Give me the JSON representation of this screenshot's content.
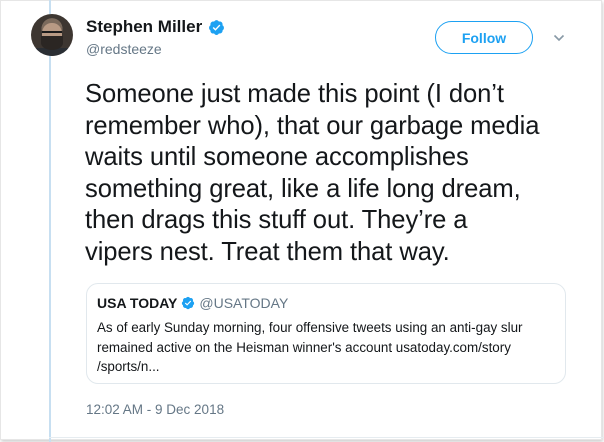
{
  "author": {
    "display_name": "Stephen Miller",
    "handle": "@redsteeze",
    "verified": true
  },
  "follow_button": {
    "label": "Follow"
  },
  "menu": {
    "icon": "chevron-down-icon"
  },
  "tweet": {
    "text": "Someone just made this point (I don’t\nremember who), that our garbage media\nwaits until someone  accomplishes\nsomething great, like a life long dream,\nthen drags this stuff out. They’re a\nvipers nest. Treat them that way.",
    "timestamp": "12:02 AM - 9 Dec 2018"
  },
  "quoted_tweet": {
    "display_name": "USA TODAY",
    "handle": "@USATODAY",
    "verified": true,
    "text": "As of early Sunday morning, four offensive tweets using an anti-gay slur\nremained active on the Heisman winner's account usatoday.com/story\n/sports/n..."
  },
  "colors": {
    "accent": "#1da1f2",
    "secondary_text": "#657786",
    "primary_text": "#14171a",
    "border": "#e1e8ed"
  }
}
